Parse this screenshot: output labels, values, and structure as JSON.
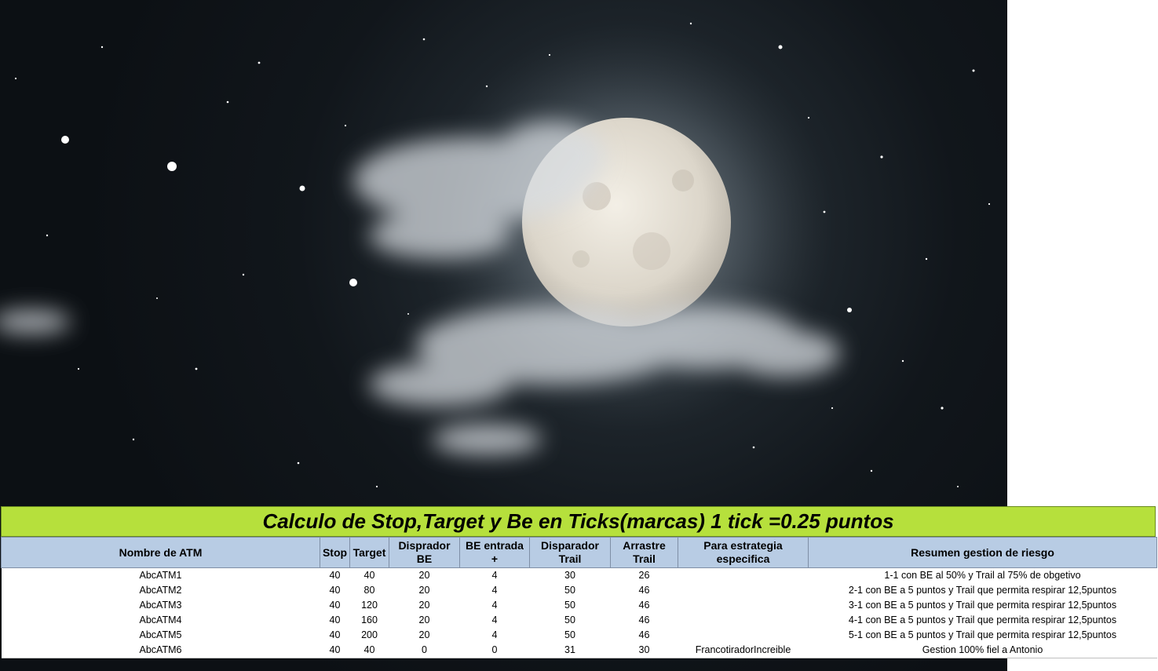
{
  "background": {
    "description_icon": "night-sky-moon-icon",
    "colors": {
      "sky": "#11161b",
      "moon": "#e6e1d6",
      "title_bar": "#b6e03c",
      "header": "#b8cce4"
    }
  },
  "sheet": {
    "title": "Calculo de Stop,Target y Be en Ticks(marcas) 1 tick =0.25 puntos",
    "headers": {
      "nombre": "Nombre de ATM",
      "stop": "Stop",
      "target": "Target",
      "disp_be": "Disprador BE",
      "be_entrada": "BE entrada +",
      "disp_trail": "Disparador Trail",
      "arrastre": "Arrastre Trail",
      "estrategia": "Para estrategia especifica",
      "resumen": "Resumen gestion de riesgo"
    },
    "rows": [
      {
        "nombre": "AbcATM1",
        "stop": "40",
        "target": "40",
        "disp_be": "20",
        "be_entrada": "4",
        "disp_trail": "30",
        "arrastre": "26",
        "estrategia": "",
        "resumen": "1-1 con BE al 50% y Trail al 75% de obgetivo"
      },
      {
        "nombre": "AbcATM2",
        "stop": "40",
        "target": "80",
        "disp_be": "20",
        "be_entrada": "4",
        "disp_trail": "50",
        "arrastre": "46",
        "estrategia": "",
        "resumen": "2-1 con BE a 5 puntos y Trail que permita respirar 12,5puntos"
      },
      {
        "nombre": "AbcATM3",
        "stop": "40",
        "target": "120",
        "disp_be": "20",
        "be_entrada": "4",
        "disp_trail": "50",
        "arrastre": "46",
        "estrategia": "",
        "resumen": "3-1 con BE a 5 puntos y Trail que permita respirar 12,5puntos"
      },
      {
        "nombre": "AbcATM4",
        "stop": "40",
        "target": "160",
        "disp_be": "20",
        "be_entrada": "4",
        "disp_trail": "50",
        "arrastre": "46",
        "estrategia": "",
        "resumen": "4-1 con BE a 5 puntos y Trail que permita respirar 12,5puntos"
      },
      {
        "nombre": "AbcATM5",
        "stop": "40",
        "target": "200",
        "disp_be": "20",
        "be_entrada": "4",
        "disp_trail": "50",
        "arrastre": "46",
        "estrategia": "",
        "resumen": "5-1 con BE a 5 puntos y Trail que permita respirar 12,5puntos"
      },
      {
        "nombre": "AbcATM6",
        "stop": "40",
        "target": "40",
        "disp_be": "0",
        "be_entrada": "0",
        "disp_trail": "31",
        "arrastre": "30",
        "estrategia": "FrancotiradorIncreible",
        "resumen": "Gestion 100% fiel a Antonio"
      }
    ]
  }
}
